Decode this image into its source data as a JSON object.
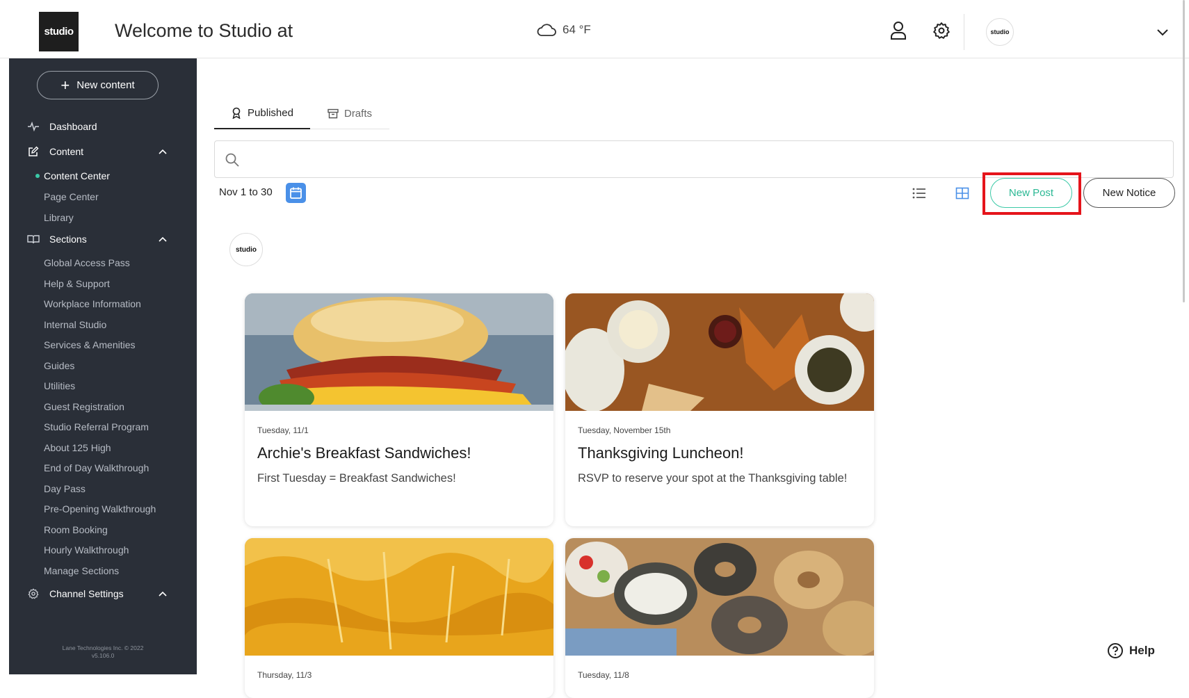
{
  "header": {
    "logo_text": "studio",
    "welcome": "Welcome to Studio at",
    "weather": "64 °F",
    "avatar_text": "studio"
  },
  "sidebar": {
    "new_content": "New content",
    "dashboard": "Dashboard",
    "content": "Content",
    "content_items": [
      "Content Center",
      "Page Center",
      "Library"
    ],
    "sections": "Sections",
    "section_items": [
      "Global Access Pass",
      "Help & Support",
      "Workplace Information",
      "Internal Studio",
      "Services & Amenities",
      "Guides",
      "Utilities",
      "Guest Registration",
      "Studio Referral Program",
      "About 125 High",
      "End of Day Walkthrough",
      "Day Pass",
      "Pre-Opening Walkthrough",
      "Room Booking",
      "Hourly Walkthrough",
      "Manage Sections"
    ],
    "channel_settings": "Channel Settings",
    "footer_line1": "Lane Technologies Inc. © 2022",
    "footer_line2": "v5.106.0"
  },
  "tabs": {
    "published": "Published",
    "drafts": "Drafts"
  },
  "search": {
    "placeholder": ""
  },
  "toolbar": {
    "date_range": "Nov 1 to 30",
    "new_post": "New Post",
    "new_notice": "New Notice"
  },
  "channel": {
    "avatar_text": "studio"
  },
  "cards": [
    {
      "date": "Tuesday, 11/1",
      "title": "Archie's Breakfast Sandwiches!",
      "desc": "First Tuesday = Breakfast Sandwiches!"
    },
    {
      "date": "Tuesday, November 15th",
      "title": "Thanksgiving Luncheon!",
      "desc": "RSVP to reserve your spot at the Thanksgiving table!"
    },
    {
      "date": "Thursday, 11/3",
      "title": "",
      "desc": ""
    },
    {
      "date": "Tuesday, 11/8",
      "title": "",
      "desc": ""
    }
  ],
  "help": {
    "label": "Help"
  },
  "colors": {
    "sidebar_bg": "#2a2f38",
    "accent": "#3bc9a7",
    "calendar_blue": "#4a90e8",
    "highlight_red": "#e5141b"
  }
}
